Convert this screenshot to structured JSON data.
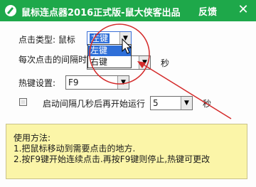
{
  "window": {
    "title": "鼠标连点器2016正式版-鼠大侠客出品",
    "feedback_label": "反馈",
    "close_glyph": "✕"
  },
  "click_type": {
    "label": "点击类型: 鼠标",
    "selected": "左键",
    "options": [
      "左键",
      "右键"
    ],
    "highlighted_option": "左键"
  },
  "interval": {
    "label": "每次点击的间隔时",
    "unit": "秒"
  },
  "hotkey": {
    "label": "热键设置:",
    "value": "F9"
  },
  "delay_start": {
    "label": "启动间隔几秒后再开始运行",
    "value": "5",
    "unit": "秒",
    "checked": false
  },
  "help": {
    "title": "使用方法:",
    "line1": "1.把鼠标移动到需要点击的地方.",
    "line2": "2.按F9键开始连续点击.再按F9键则停止,热键可更改"
  },
  "colors": {
    "titlebar": "#1ea84a",
    "annotation": "#d42a2a",
    "help_bg": "#fbf5a8",
    "selection": "#2f6fd8"
  }
}
